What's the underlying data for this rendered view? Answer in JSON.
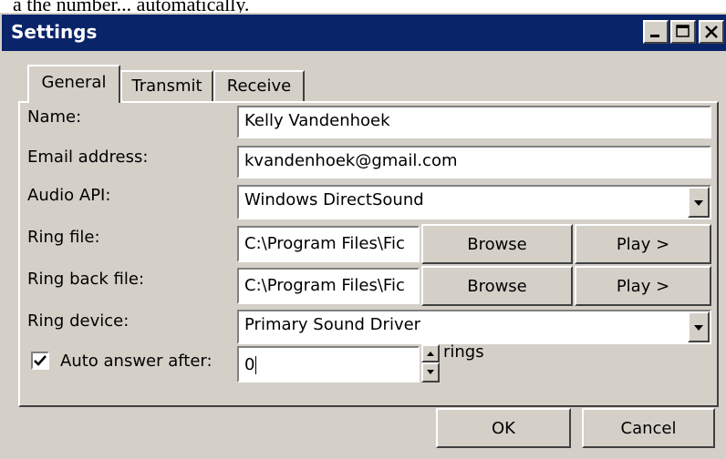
{
  "caption_text": "a the number... automatically.",
  "window": {
    "title": "Settings"
  },
  "tabs": [
    {
      "label": "General"
    },
    {
      "label": "Transmit"
    },
    {
      "label": "Receive"
    }
  ],
  "form": {
    "name_label": "Name:",
    "name_value": "Kelly Vandenhoek",
    "email_label": "Email address:",
    "email_value": "kvandenhoek@gmail.com",
    "audio_api_label": "Audio API:",
    "audio_api_value": "Windows DirectSound",
    "ring_file_label": "Ring file:",
    "ring_file_value": "C:\\Program Files\\Fic",
    "ring_back_label": "Ring back file:",
    "ring_back_value": "C:\\Program Files\\Fic",
    "browse_label": "Browse",
    "play_label": "Play >",
    "ring_device_label": "Ring device:",
    "ring_device_value": "Primary Sound Driver",
    "auto_answer_label": "Auto answer after:",
    "auto_answer_checked": true,
    "auto_answer_value": "0",
    "rings_label": "rings"
  },
  "footer": {
    "ok_label": "OK",
    "cancel_label": "Cancel"
  },
  "colors": {
    "title_bar": "#0a246a",
    "face": "#d4d0c8",
    "field": "#ffffff"
  },
  "icons": [
    "minimize-icon",
    "maximize-icon",
    "close-icon",
    "dropdown-arrow-icon",
    "checkmark-icon",
    "spin-up-icon",
    "spin-down-icon"
  ]
}
